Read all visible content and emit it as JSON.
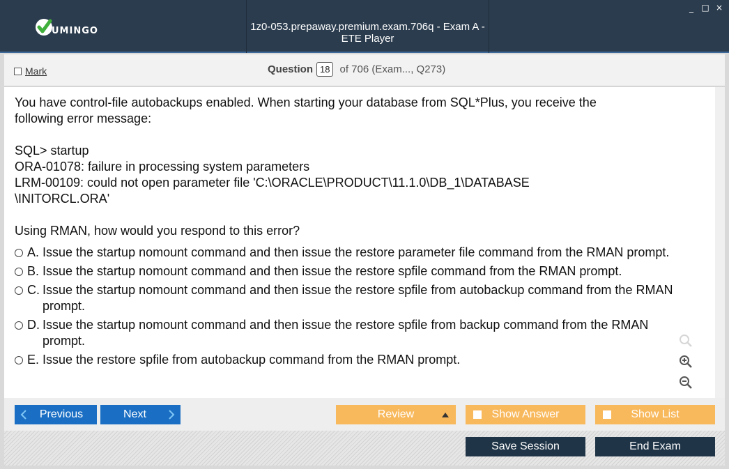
{
  "window": {
    "title": "1z0-053.prepaway.premium.exam.706q - Exam A - ETE Player",
    "logo_text": "UMINGO",
    "controls": [
      "_",
      "□",
      "×"
    ]
  },
  "header": {
    "mark_label": "Mark",
    "question_label": "Question",
    "question_number": "18",
    "question_total": "of 706 (Exam..., Q273)"
  },
  "question": {
    "lines": [
      "You have control-file autobackups enabled. When starting your database from SQL*Plus, you receive the",
      "following error message:"
    ],
    "code": [
      "SQL> startup",
      "ORA-01078: failure in processing system parameters",
      "LRM-00109: could not open parameter file 'C:\\ORACLE\\PRODUCT\\11.1.0\\DB_1\\DATABASE",
      "\\INITORCL.ORA'"
    ],
    "prompt": "Using RMAN, how would you respond to this error?",
    "options": [
      {
        "letter": "A.",
        "text": "Issue the startup nomount command and then issue the restore parameter file command from the RMAN prompt."
      },
      {
        "letter": "B.",
        "text": "Issue the startup nomount command and then issue the restore spfile command from the RMAN prompt."
      },
      {
        "letter": "C.",
        "text": "Issue the startup nomount command and then issue the restore spfile from autobackup command from the RMAN prompt."
      },
      {
        "letter": "D.",
        "text": "Issue the startup nomount command and then issue the restore spfile from backup command from the RMAN prompt."
      },
      {
        "letter": "E.",
        "text": "Issue the restore spfile from autobackup command from the RMAN prompt."
      }
    ]
  },
  "nav": {
    "previous": "Previous",
    "next": "Next",
    "review": "Review",
    "show_answer": "Show Answer",
    "show_list": "Show List"
  },
  "footer": {
    "save_session": "Save Session",
    "end_exam": "End Exam"
  },
  "colors": {
    "titlebar": "#2b3c4e",
    "blue_button": "#1a6fc4",
    "orange_button": "#f8b85c",
    "dark_button": "#1f3447"
  }
}
